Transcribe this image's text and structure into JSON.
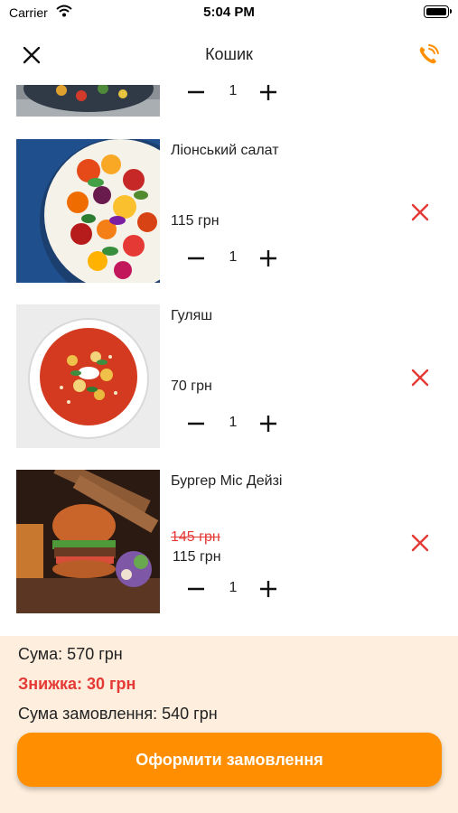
{
  "status_bar": {
    "carrier": "Carrier",
    "time": "5:04 PM"
  },
  "header": {
    "title": "Кошик",
    "close_icon": "close-icon",
    "phone_icon": "phone-icon"
  },
  "colors": {
    "accent": "#ff8f00",
    "danger": "#e53935",
    "summary_bg": "#fdeedd"
  },
  "cart": {
    "items": [
      {
        "name": "",
        "price": "",
        "quantity": "1"
      },
      {
        "name": "Ліонський салат",
        "price": "115 грн",
        "quantity": "1"
      },
      {
        "name": "Гуляш",
        "price": "70 грн",
        "quantity": "1"
      },
      {
        "name": "Бургер Міс Дейзі",
        "old_price": "145 грн",
        "price": "115 грн",
        "quantity": "1"
      }
    ]
  },
  "summary": {
    "total": "Сума: 570 грн",
    "discount": "Знижка: 30 грн",
    "order_total": "Сума замовлення: 540 грн",
    "checkout_label": "Оформити замовлення"
  }
}
